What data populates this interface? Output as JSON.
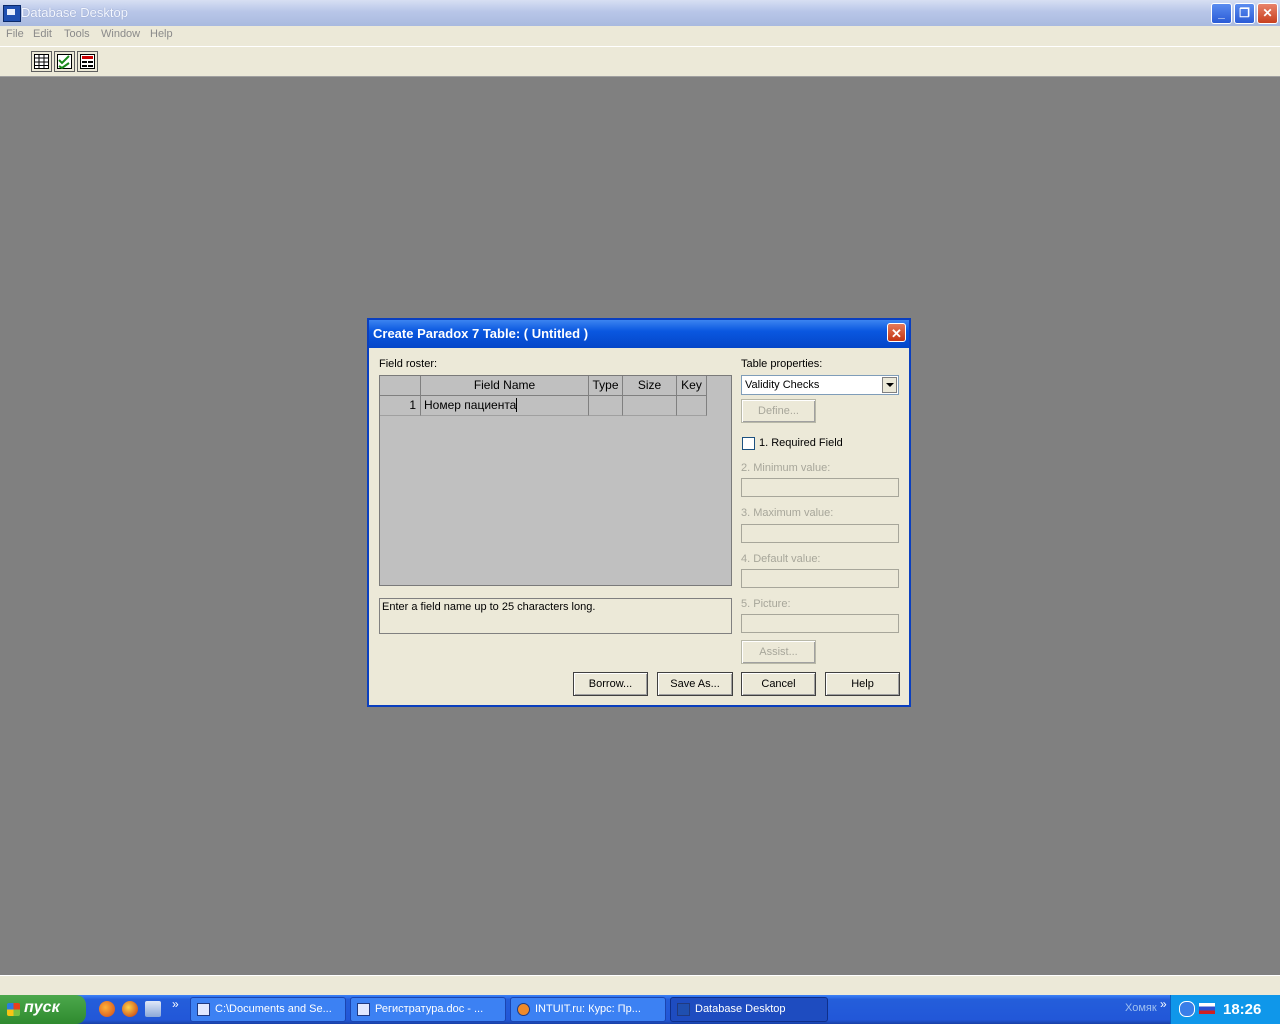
{
  "window": {
    "title": "Database Desktop",
    "controls": {
      "minimize": "_",
      "restore": "❐",
      "close": "✕"
    }
  },
  "menu": [
    "File",
    "Edit",
    "Tools",
    "Window",
    "Help"
  ],
  "toolbar": {
    "icons": [
      "table-icon",
      "checklist-icon",
      "form-icon"
    ]
  },
  "dialog": {
    "title": "Create Paradox 7 Table:  ( Untitled )",
    "close": "✕",
    "field_roster_label": "Field roster:",
    "columns": [
      "Field Name",
      "Type",
      "Size",
      "Key"
    ],
    "rows": [
      {
        "num": "1",
        "field_name": "Номер пациента",
        "type": "",
        "size": "",
        "key": ""
      }
    ],
    "hint": "Enter a field name up to 25 characters long.",
    "table_properties_label": "Table properties:",
    "table_properties_value": "Validity Checks",
    "define_button": "Define...",
    "required_field": "1. Required Field",
    "minimum_value": "2. Minimum value:",
    "maximum_value": "3. Maximum value:",
    "default_value": "4. Default value:",
    "picture": "5. Picture:",
    "assist_button": "Assist...",
    "buttons": {
      "borrow": "Borrow...",
      "save_as": "Save As...",
      "cancel": "Cancel",
      "help": "Help"
    }
  },
  "taskbar": {
    "start": "пуск",
    "tasks": [
      "C:\\Documents and Se...",
      "Регистратура.doc - ...",
      "INTUIT.ru: Курс: Пр...",
      "Database Desktop"
    ],
    "chevron": "»",
    "tray_text": "Хомяк",
    "clock": "18:26"
  },
  "colors": {
    "desktop": "#808080",
    "dialog_title": "#0a57e0",
    "taskbar": "#245edb",
    "start": "#3c9a3c"
  }
}
